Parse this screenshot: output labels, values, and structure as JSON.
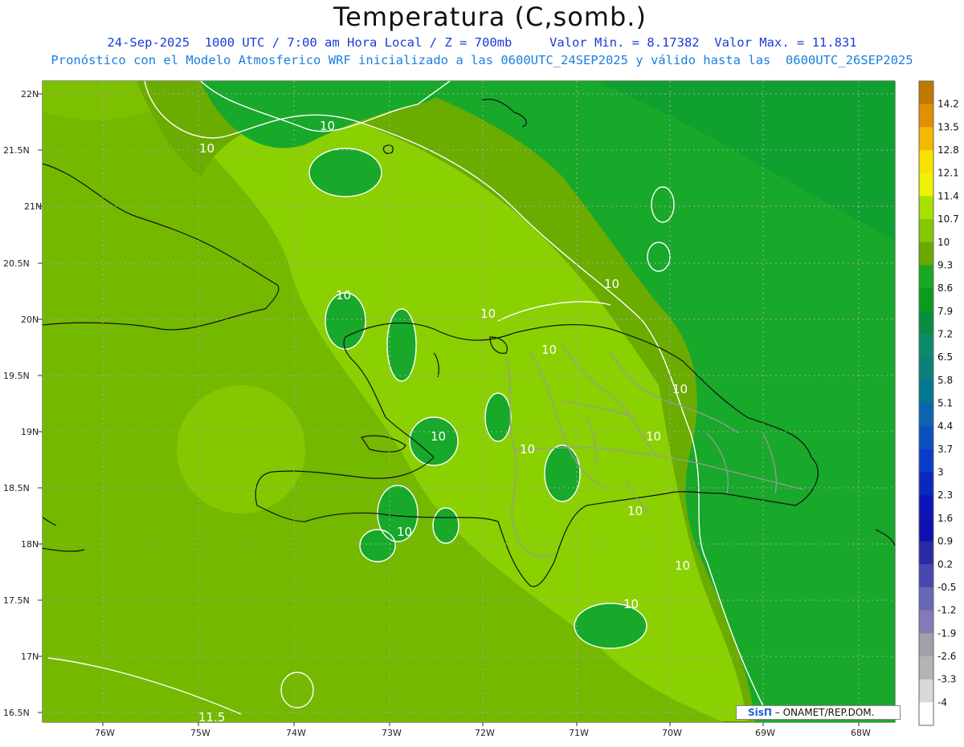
{
  "title": "Temperatura (C,somb.)",
  "subtitle_line1": "24-Sep-2025  1000 UTC / 7:00 am Hora Local / Z = 700mb     Valor Min. = 8.17382  Valor Max. = 11.831",
  "subtitle_line2": "Pronóstico con el Modelo Atmosferico WRF inicializado a las 0600UTC_24SEP2025 y válido hasta las  0600UTC_26SEP2025",
  "axes": {
    "lat_labels": [
      "22N",
      "21.5N",
      "21N",
      "20.5N",
      "20N",
      "19.5N",
      "19N",
      "18.5N",
      "18N",
      "17.5N",
      "17N",
      "16.5N"
    ],
    "lon_labels": [
      "76W",
      "75W",
      "74W",
      "73W",
      "72W",
      "71W",
      "70W",
      "69W",
      "68W"
    ]
  },
  "colorbar": {
    "labels": [
      "14.2",
      "13.5",
      "12.8",
      "12.1",
      "11.4",
      "10.7",
      "10",
      "9.3",
      "8.6",
      "7.9",
      "7.2",
      "6.5",
      "5.8",
      "5.1",
      "4.4",
      "3.7",
      "3",
      "2.3",
      "1.6",
      "0.9",
      "0.2",
      "-0.5",
      "-1.2",
      "-1.9",
      "-2.6",
      "-3.3",
      "-4"
    ],
    "colors": [
      "#c07800",
      "#e09000",
      "#f5b800",
      "#f8e000",
      "#eef400",
      "#a8e000",
      "#86c800",
      "#6aaa00",
      "#1aa824",
      "#0c9c1c",
      "#0a8c40",
      "#0a8c6c",
      "#0a8078",
      "#007890",
      "#0c64b0",
      "#0c50c0",
      "#0a3cc8",
      "#0a28c0",
      "#0a14b8",
      "#1010b0",
      "#2a2aa8",
      "#4848b0",
      "#6868b8",
      "#8878b8",
      "#a0a0a8",
      "#b4b4b4",
      "#d8d8d8",
      "#ffffff"
    ]
  },
  "contour_labels": [
    "10",
    "10",
    "10",
    "10",
    "10",
    "10",
    "10",
    "10",
    "10",
    "10",
    "10",
    "10",
    "10",
    "10",
    "11.5"
  ],
  "credit": {
    "logo": "SisΠ",
    "text": " – ONAMET/REP.DOM."
  }
}
